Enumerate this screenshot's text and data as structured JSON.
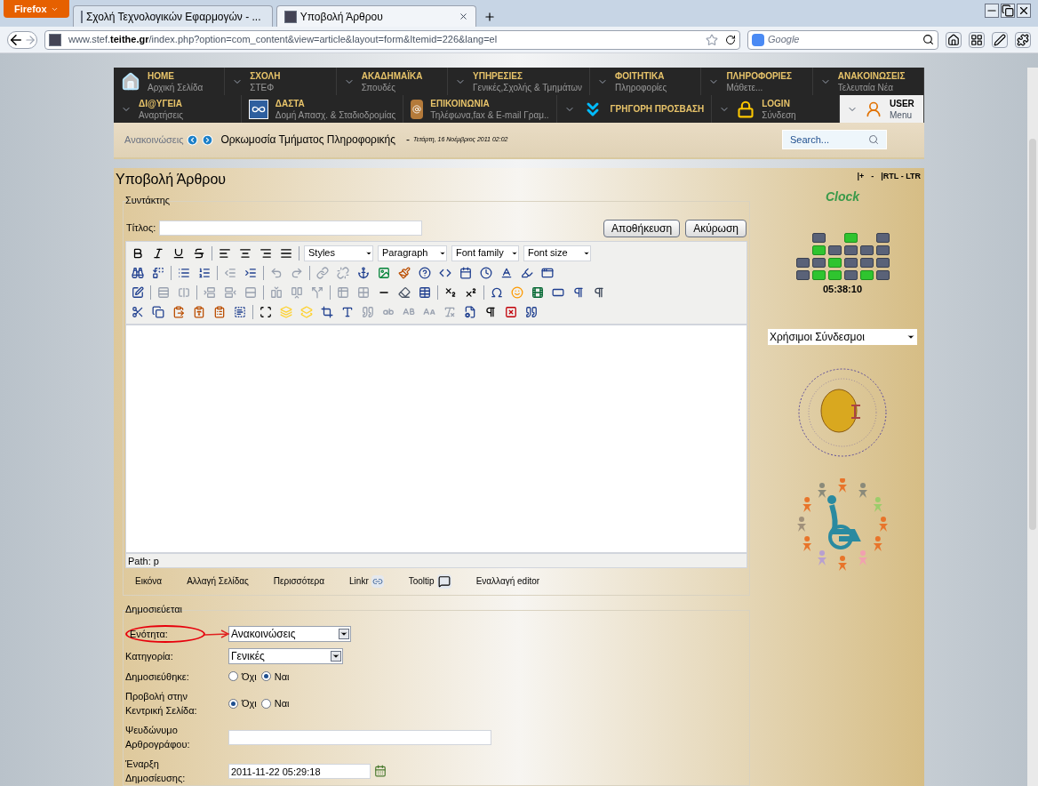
{
  "browser": {
    "menu_button": "Firefox",
    "tabs": [
      {
        "label": "Σχολή Τεχνολογικών Εφαρμογών - ...",
        "selected": false
      },
      {
        "label": "Υποβολή Άρθρου",
        "selected": true
      }
    ],
    "url_prefix": "www.stef.",
    "url_domain": "teithe.gr",
    "url_rest": "/index.php?option=com_content&view=article&layout=form&Itemid=226&lang=el",
    "search_placeholder": "Google"
  },
  "nav": [
    [
      {
        "title": "HOME",
        "subtitle": "Αρχική Σελίδα",
        "kind": "home",
        "selected": false
      },
      {
        "title": "ΣΧΟΛΗ",
        "subtitle": "ΣΤΕΦ",
        "kind": "caret",
        "selected": false
      },
      {
        "title": "ΑΚΑΔΗΜΑΪΚΑ",
        "subtitle": "Σπουδές",
        "kind": "caret",
        "selected": false
      },
      {
        "title": "ΥΠΗΡΕΣΙΕΣ",
        "subtitle": "Γενικές,Σχολής & Τμημάτων",
        "kind": "caret",
        "selected": false
      },
      {
        "title": "ΦΟΙΤΗΤΙΚΑ",
        "subtitle": "Πληροφορίες",
        "kind": "caret",
        "selected": false
      },
      {
        "title": "ΠΛΗΡΟΦΟΡΙΕΣ",
        "subtitle": "Μάθετε...",
        "kind": "caret",
        "selected": false
      },
      {
        "title": "ΑΝΑΚΟΙΝΩΣΕΙΣ",
        "subtitle": "Τελευταία Νέα",
        "kind": "caret",
        "selected": false
      }
    ],
    [
      {
        "title": "ΔΙ@ΥΓΕΙΑ",
        "subtitle": "Αναρτήσεις",
        "kind": "caret",
        "selected": false
      },
      {
        "title": "ΔΑΣΤΑ",
        "subtitle": "Δομή Απασχ. & Σταδιοδρομίας",
        "kind": "logo",
        "selected": false
      },
      {
        "title": "ΕΠΙΚΟΙΝΩΝΙΑ",
        "subtitle": "Τηλέφωνα,fax & E-mail Γραμ..",
        "kind": "book",
        "selected": false
      },
      {
        "title": "ΓΡΗΓΟΡΗ ΠΡΟΣΒΑΣΗ",
        "kind": "arrow",
        "selected": false
      },
      {
        "title": "LOGIN",
        "subtitle": "Σύνδεση",
        "kind": "lock",
        "selected": false
      },
      {
        "title": "USER",
        "subtitle": "Menu",
        "kind": "user",
        "selected": true
      }
    ]
  ],
  "breadcrumb": {
    "section": "Ανακοινώσεις",
    "title": "Ορκωμοσία Τμήματος Πληροφορικής",
    "separator": "-",
    "date": "Τετάρτη, 16 Νοέμβριος 2011 02:02",
    "search_placeholder": "Search..."
  },
  "page_title": "Υποβολή Άρθρου",
  "page_tools": [
    "|+",
    "-",
    "|RTL - LTR"
  ],
  "editor": {
    "legend": "Συντάκτης",
    "title_label": "Τίτλος:",
    "buttons": [
      "Αποθήκευση",
      "Ακύρωση"
    ],
    "selects": [
      "Styles",
      "Paragraph",
      "Font family",
      "Font size"
    ],
    "path": "Path: p",
    "links": [
      {
        "label": "Εικόνα",
        "kind": "plain"
      },
      {
        "label": "Αλλαγή Σελίδας",
        "kind": "plain"
      },
      {
        "label": "Περισσότερα",
        "kind": "plain"
      },
      {
        "label": "Linkr",
        "kind": "link"
      },
      {
        "label": "Tooltip",
        "kind": "tooltip"
      },
      {
        "label": "Εναλλαγή editor",
        "kind": "plain"
      }
    ]
  },
  "publish": {
    "legend": "Δημοσιεύεται",
    "rows": [
      {
        "kind": "select",
        "label": "Ενότητα:",
        "value": "Ανακοινώσεις",
        "circled": true
      },
      {
        "kind": "select",
        "label": "Κατηγορία:",
        "value": "Γενικές",
        "circled": false
      },
      {
        "kind": "radio",
        "label": "Δημοσιεύθηκε:",
        "options": [
          {
            "label": "Όχι",
            "selected": false
          },
          {
            "label": "Ναι",
            "selected": true
          }
        ]
      },
      {
        "kind": "radio",
        "label": "Προβολή στην Κεντρική Σελίδα:",
        "options": [
          {
            "label": "Όχι",
            "selected": true
          },
          {
            "label": "Ναι",
            "selected": false
          }
        ]
      },
      {
        "kind": "input",
        "label": "Ψευδώνυμο Αρθρογράφου:",
        "value": ""
      },
      {
        "kind": "date",
        "label": "Έναρξη Δημοσίευσης:",
        "value": "2011-11-22 05:29:18"
      }
    ]
  },
  "sidebar": {
    "clock_title": "Clock",
    "clock_columns": [
      [
        null,
        null,
        false,
        false
      ],
      [
        false,
        true,
        false,
        true
      ],
      [
        null,
        false,
        true,
        true
      ],
      [
        true,
        false,
        false,
        false
      ],
      [
        null,
        false,
        false,
        true
      ],
      [
        false,
        false,
        false,
        false
      ]
    ],
    "time": "05:38:10",
    "links_select": "Χρήσιμοι Σύνδεσμοι"
  }
}
